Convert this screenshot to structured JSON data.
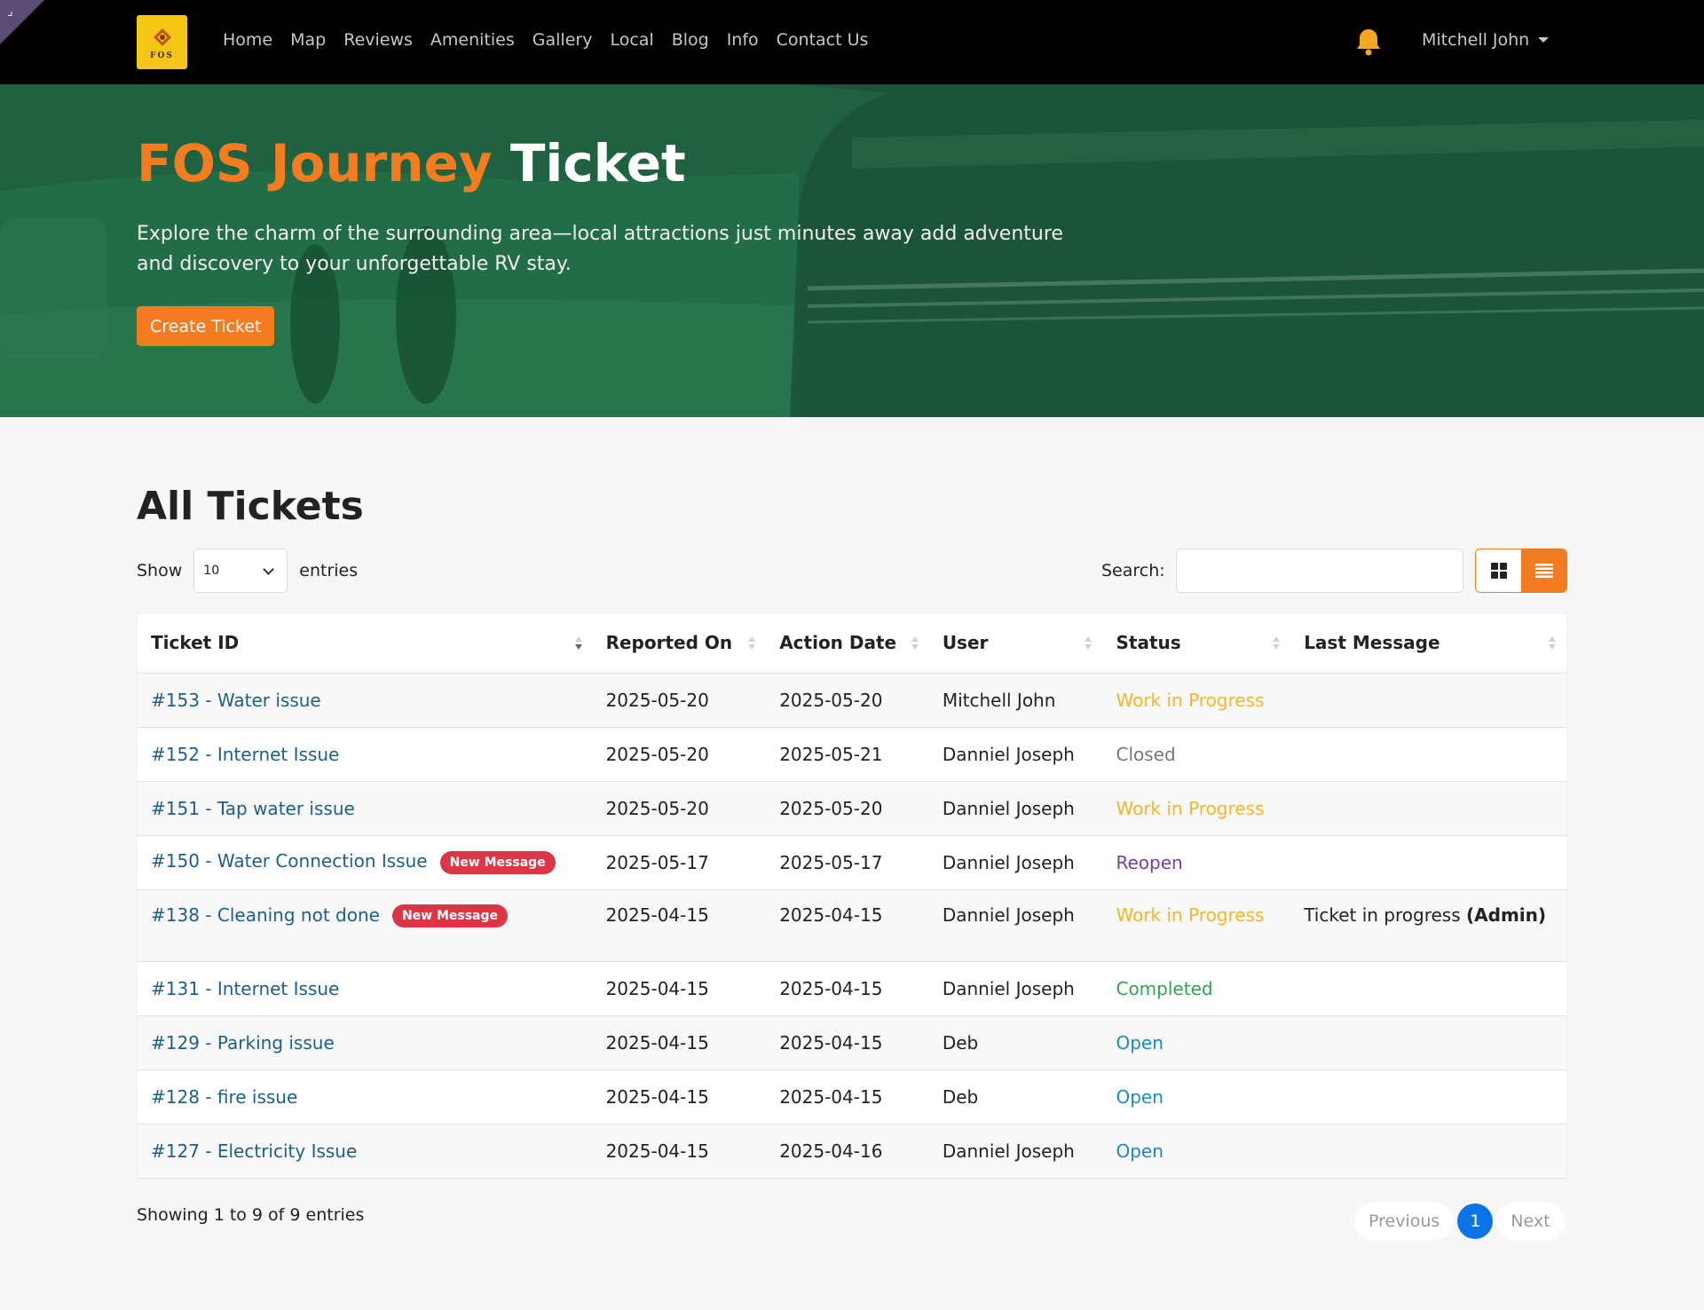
{
  "nav": {
    "logo_text": "FOS",
    "links": [
      "Home",
      "Map",
      "Reviews",
      "Amenities",
      "Gallery",
      "Local",
      "Blog",
      "Info",
      "Contact Us"
    ],
    "user": "Mitchell John"
  },
  "hero": {
    "title_brand": "FOS Journey",
    "title_rest": "Ticket",
    "subtitle": "Explore the charm of the surrounding area—local attractions just minutes away add adventure and discovery to your unforgettable RV stay.",
    "cta": "Create Ticket"
  },
  "tickets": {
    "title": "All Tickets",
    "show_label": "Show",
    "entries_value": "10",
    "entries_label": "entries",
    "search_label": "Search:",
    "columns": [
      "Ticket ID",
      "Reported On",
      "Action Date",
      "User",
      "Status",
      "Last Message"
    ],
    "rows": [
      {
        "ticket": "#153 - Water issue",
        "badge": "",
        "reported": "2025-05-20",
        "action": "2025-05-20",
        "user": "Mitchell John",
        "status": "Work in Progress",
        "msg": "",
        "msg_by": ""
      },
      {
        "ticket": "#152 - Internet Issue",
        "badge": "",
        "reported": "2025-05-20",
        "action": "2025-05-21",
        "user": "Danniel Joseph",
        "status": "Closed",
        "msg": "",
        "msg_by": ""
      },
      {
        "ticket": "#151 - Tap water issue",
        "badge": "",
        "reported": "2025-05-20",
        "action": "2025-05-20",
        "user": "Danniel Joseph",
        "status": "Work in Progress",
        "msg": "",
        "msg_by": ""
      },
      {
        "ticket": "#150 - Water Connection Issue",
        "badge": "New Message",
        "reported": "2025-05-17",
        "action": "2025-05-17",
        "user": "Danniel Joseph",
        "status": "Reopen",
        "msg": "",
        "msg_by": ""
      },
      {
        "ticket": "#138 - Cleaning not done",
        "badge": "New Message",
        "reported": "2025-04-15",
        "action": "2025-04-15",
        "user": "Danniel Joseph",
        "status": "Work in Progress",
        "msg": "Ticket in progress",
        "msg_by": "(Admin)"
      },
      {
        "ticket": "#131 - Internet Issue",
        "badge": "",
        "reported": "2025-04-15",
        "action": "2025-04-15",
        "user": "Danniel Joseph",
        "status": "Completed",
        "msg": "",
        "msg_by": ""
      },
      {
        "ticket": "#129 - Parking issue",
        "badge": "",
        "reported": "2025-04-15",
        "action": "2025-04-15",
        "user": "Deb",
        "status": "Open",
        "msg": "",
        "msg_by": ""
      },
      {
        "ticket": "#128 - fire issue",
        "badge": "",
        "reported": "2025-04-15",
        "action": "2025-04-15",
        "user": "Deb",
        "status": "Open",
        "msg": "",
        "msg_by": ""
      },
      {
        "ticket": "#127 - Electricity Issue",
        "badge": "",
        "reported": "2025-04-15",
        "action": "2025-04-16",
        "user": "Danniel Joseph",
        "status": "Open",
        "msg": "",
        "msg_by": ""
      }
    ],
    "showing": "Showing 1 to 9 of 9 entries",
    "pagination": {
      "prev": "Previous",
      "current": "1",
      "next": "Next"
    }
  },
  "colors": {
    "accent": "#f47c20",
    "hero_green": "#236c46",
    "status_wip": "#f0b82a",
    "status_closed": "#777777",
    "status_reopen": "#7a3f9a",
    "status_completed": "#2ea44f",
    "status_open": "#1a8bbf",
    "badge_red": "#dc3545"
  }
}
